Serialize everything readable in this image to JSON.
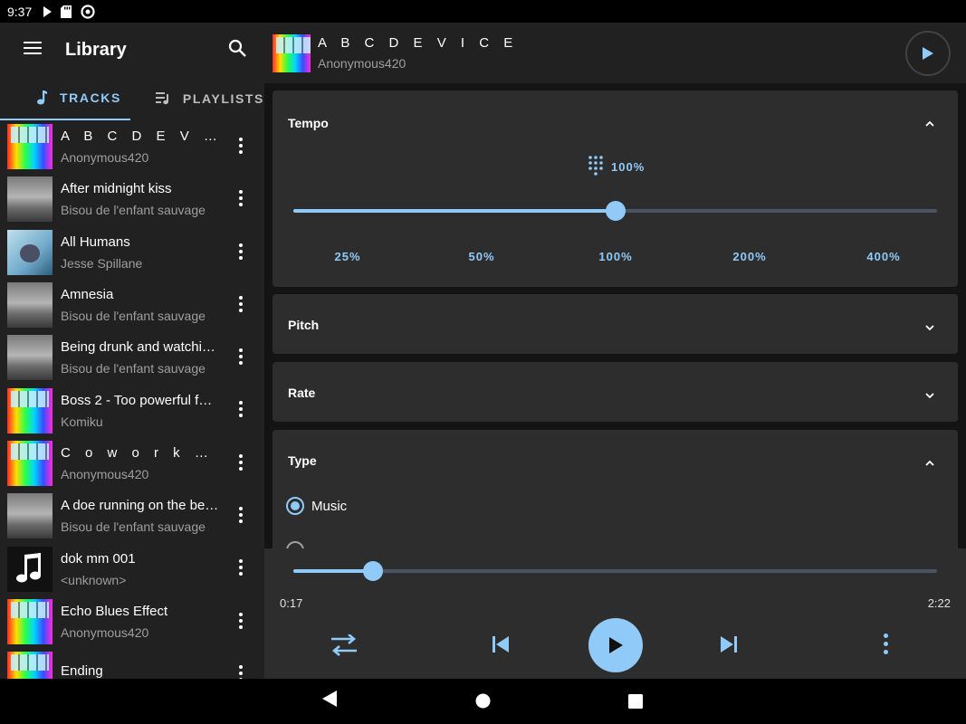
{
  "status_bar": {
    "time": "9:37"
  },
  "library": {
    "title": "Library",
    "tabs": [
      {
        "label": "TRACKS",
        "active": true
      },
      {
        "label": "PLAYLISTS",
        "active": false
      }
    ],
    "tracks": [
      {
        "title": "A B C D E V I C E",
        "artist": "Anonymous420",
        "art": "rainbow",
        "spaced": true
      },
      {
        "title": "After midnight kiss",
        "artist": "Bisou de l'enfant sauvage",
        "art": "gray"
      },
      {
        "title": "All Humans",
        "artist": "Jesse Spillane",
        "art": "blue"
      },
      {
        "title": "Amnesia",
        "artist": "Bisou de l'enfant sauvage",
        "art": "gray"
      },
      {
        "title": "Being drunk and watchi…",
        "artist": "Bisou de l'enfant sauvage",
        "art": "gray"
      },
      {
        "title": "Boss 2 - Too powerful f…",
        "artist": "Komiku",
        "art": "rainbow"
      },
      {
        "title": "C o w o r k  P a r t…",
        "artist": "Anonymous420",
        "art": "rainbow",
        "spaced": true
      },
      {
        "title": "A doe running on the be…",
        "artist": "Bisou de l'enfant sauvage",
        "art": "gray"
      },
      {
        "title": "dok mm 001",
        "artist": "<unknown>",
        "art": "note"
      },
      {
        "title": "Echo Blues Effect",
        "artist": "Anonymous420",
        "art": "rainbow"
      },
      {
        "title": "Ending",
        "artist": "",
        "art": "rainbow"
      }
    ]
  },
  "now_playing": {
    "title": "A B C D E V I C E",
    "artist": "Anonymous420"
  },
  "tempo": {
    "heading": "Tempo",
    "value_label": "100%",
    "value_fraction": 0.5,
    "ticks": [
      "25%",
      "50%",
      "100%",
      "200%",
      "400%"
    ]
  },
  "pitch": {
    "heading": "Pitch"
  },
  "rate": {
    "heading": "Rate"
  },
  "type": {
    "heading": "Type",
    "options": [
      {
        "label": "Music",
        "selected": true
      }
    ]
  },
  "player": {
    "elapsed": "0:17",
    "duration": "2:22",
    "progress_fraction": 0.124
  },
  "colors": {
    "accent": "#90caf9",
    "panel": "#2d2d2d",
    "sidebar": "#212121"
  }
}
